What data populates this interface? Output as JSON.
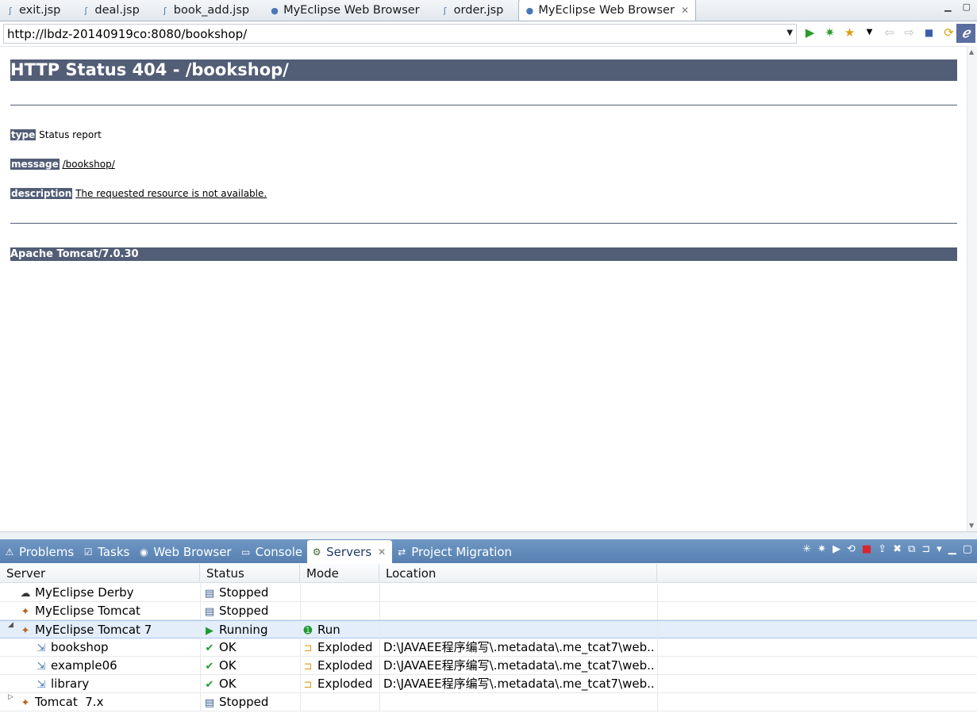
{
  "editor_tabs": [
    {
      "label": "exit.jsp",
      "icon": "jsp-file-icon"
    },
    {
      "label": "deal.jsp",
      "icon": "jsp-file-icon"
    },
    {
      "label": "book_add.jsp",
      "icon": "jsp-file-icon"
    },
    {
      "label": "MyEclipse Web Browser",
      "icon": "globe-icon"
    },
    {
      "label": "order.jsp",
      "icon": "jsp-file-icon"
    },
    {
      "label": "MyEclipse Web Browser",
      "icon": "globe-icon",
      "active": true
    }
  ],
  "browser": {
    "url": "http://lbdz-20140919co:8080/bookshop/"
  },
  "page": {
    "title": "HTTP Status 404 - /bookshop/",
    "type_label": "type",
    "type_value": "Status report",
    "message_label": "message",
    "message_value": "/bookshop/",
    "description_label": "description",
    "description_value": "The requested resource is not available.",
    "footer": "Apache Tomcat/7.0.30"
  },
  "view_tabs": [
    {
      "label": "Problems",
      "icon": "problems-icon"
    },
    {
      "label": "Tasks",
      "icon": "tasks-icon"
    },
    {
      "label": "Web Browser",
      "icon": "globe-icon"
    },
    {
      "label": "Console",
      "icon": "console-icon"
    },
    {
      "label": "Servers",
      "icon": "servers-icon",
      "active": true
    },
    {
      "label": "Project Migration",
      "icon": "migration-icon"
    }
  ],
  "servers_table": {
    "columns": [
      "Server",
      "Status",
      "Mode",
      "Location"
    ],
    "rows": [
      {
        "server": "MyEclipse Derby",
        "status": "Stopped",
        "mode": "",
        "location": ""
      },
      {
        "server": "MyEclipse Tomcat",
        "status": "Stopped",
        "mode": "",
        "location": ""
      },
      {
        "server": "MyEclipse Tomcat 7",
        "status": "Running",
        "mode": "Run",
        "location": ""
      },
      {
        "server": "bookshop",
        "status": "OK",
        "mode": "Exploded",
        "location": "D:\\JAVAEE程序编写\\.metadata\\.me_tcat7\\web..."
      },
      {
        "server": "example06",
        "status": "OK",
        "mode": "Exploded",
        "location": "D:\\JAVAEE程序编写\\.metadata\\.me_tcat7\\web..."
      },
      {
        "server": "library",
        "status": "OK",
        "mode": "Exploded",
        "location": "D:\\JAVAEE程序编写\\.metadata\\.me_tcat7\\web..."
      },
      {
        "server": "Tomcat  7.x",
        "status": "Stopped",
        "mode": "",
        "location": ""
      }
    ]
  }
}
